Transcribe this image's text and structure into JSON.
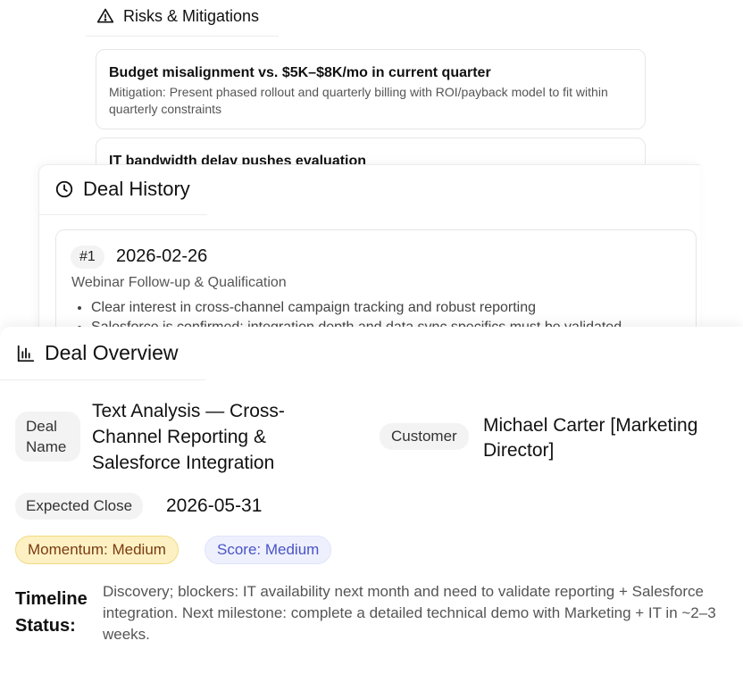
{
  "risks": {
    "title": "Risks & Mitigations",
    "icon": "warning-icon",
    "items": [
      {
        "title": "Budget misalignment vs. $5K–$8K/mo in current quarter",
        "mitigation": "Mitigation: Present phased rollout and quarterly billing with ROI/payback model to fit within quarterly constraints"
      },
      {
        "title": "IT bandwidth delay pushes evaluation",
        "mitigation": ""
      }
    ]
  },
  "history": {
    "title": "Deal History",
    "icon": "clock-icon",
    "entries": [
      {
        "number": "#1",
        "date": "2026-02-26",
        "title": "Webinar Follow-up & Qualification",
        "bullets": [
          "Clear interest in cross-channel campaign tracking and robust reporting",
          "Salesforce is confirmed; integration depth and data sync specifics must be validated"
        ]
      }
    ]
  },
  "overview": {
    "title": "Deal Overview",
    "icon": "bar-chart-icon",
    "deal_name_label": "Deal Name",
    "deal_name_value": "Text Analysis — Cross-Channel Reporting & Salesforce Integration",
    "customer_label": "Customer",
    "customer_value": "Michael Carter [Marketing Director]",
    "close_label": "Expected Close",
    "close_value": "2026-05-31",
    "momentum_badge": "Momentum: Medium",
    "score_badge": "Score: Medium",
    "timeline_label": "Timeline Status:",
    "timeline_text": "Discovery; blockers: IT availability next month and need to validate reporting + Salesforce integration. Next milestone: complete a detailed technical demo with Marketing + IT in ~2–3 weeks.",
    "colors": {
      "momentum_bg": "#fdf1c4",
      "momentum_text": "#7a3b10",
      "score_bg": "#eef0fd",
      "score_text": "#4954c6"
    }
  }
}
